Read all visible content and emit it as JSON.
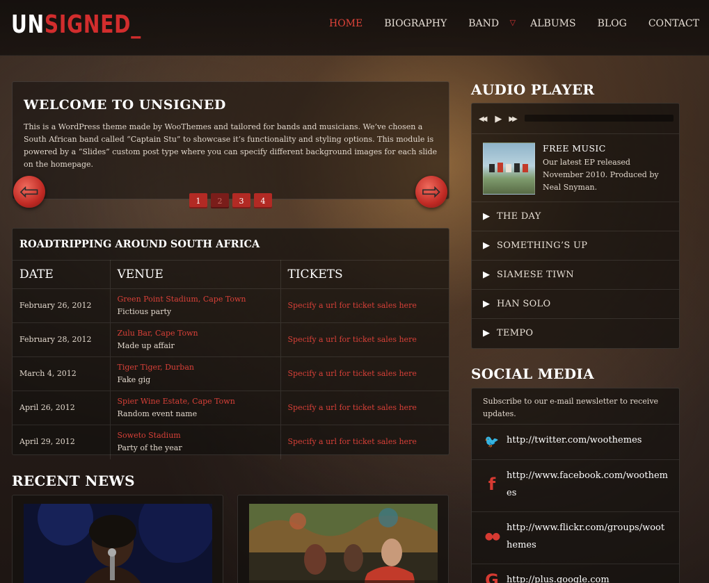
{
  "logo": {
    "un": "UN",
    "signed": "SIGNED_"
  },
  "nav": {
    "home": "HOME",
    "biography": "BIOGRAPHY",
    "band": "BAND",
    "band_mark": "▽",
    "albums": "ALBUMS",
    "blog": "BLOG",
    "contact": "CONTACT"
  },
  "slider": {
    "title": "WELCOME TO UNSIGNED",
    "text": "This is a WordPress theme made by WooThemes and tailored for bands and musicians. We’ve chosen a South African band called “Captain Stu” to showcase it’s functionality and styling options. This module is powered by a “Slides” custom post type where you can specify different background images for each slide on the homepage.",
    "prev_glyph": "⇦",
    "next_glyph": "⇨",
    "pages": [
      "1",
      "2",
      "3",
      "4"
    ]
  },
  "tour": {
    "title": "ROADTRIPPING AROUND SOUTH AFRICA",
    "headers": {
      "date": "DATE",
      "venue": "VENUE",
      "tickets": "TICKETS"
    },
    "rows": [
      {
        "date": "February 26, 2012",
        "venue": "Green Point Stadium, Cape Town",
        "event": "Fictious party",
        "tickets": "Specify a url for ticket sales here"
      },
      {
        "date": "February 28, 2012",
        "venue": "Zulu Bar, Cape Town",
        "event": "Made up affair",
        "tickets": "Specify a url for ticket sales here"
      },
      {
        "date": "March 4, 2012",
        "venue": "Tiger Tiger, Durban",
        "event": "Fake gig",
        "tickets": "Specify a url for ticket sales here"
      },
      {
        "date": "April 26, 2012",
        "venue": "Spier Wine Estate, Cape Town",
        "event": "Random event name",
        "tickets": "Specify a url for ticket sales here"
      },
      {
        "date": "April 29, 2012",
        "venue": "Soweto Stadium",
        "event": "Party of the year",
        "tickets": "Specify a url for ticket sales here"
      }
    ]
  },
  "news": {
    "title": "RECENT NEWS"
  },
  "player": {
    "title": "AUDIO PLAYER",
    "prev_glyph": "◀◀",
    "play_glyph": "▶",
    "next_glyph": "▶▶",
    "album_title": "FREE MUSIC",
    "album_desc": "Our latest EP released November 2010. Produced by Neal Snyman.",
    "track_glyph": "▶",
    "tracks": [
      "THE DAY",
      "SOMETHING’S UP",
      "SIAMESE TIWN",
      "HAN SOLO",
      "TEMPO"
    ]
  },
  "social": {
    "title": "SOCIAL MEDIA",
    "intro": "Subscribe to our e-mail newsletter to receive updates.",
    "links": [
      {
        "icon": "twitter-icon",
        "glyph": "🐦",
        "url": "http://twitter.com/woothemes"
      },
      {
        "icon": "facebook-icon",
        "glyph": "f",
        "url": "http://www.facebook.com/woothemes"
      },
      {
        "icon": "flickr-icon",
        "glyph": "●●",
        "url": "http://www.flickr.com/groups/woothemes"
      },
      {
        "icon": "google-plus-icon",
        "glyph": "G",
        "url": "http://plus.google.com"
      }
    ]
  },
  "colors": {
    "accent": "#d22d2d",
    "link": "#d84038",
    "nav_active": "#e0443a"
  }
}
